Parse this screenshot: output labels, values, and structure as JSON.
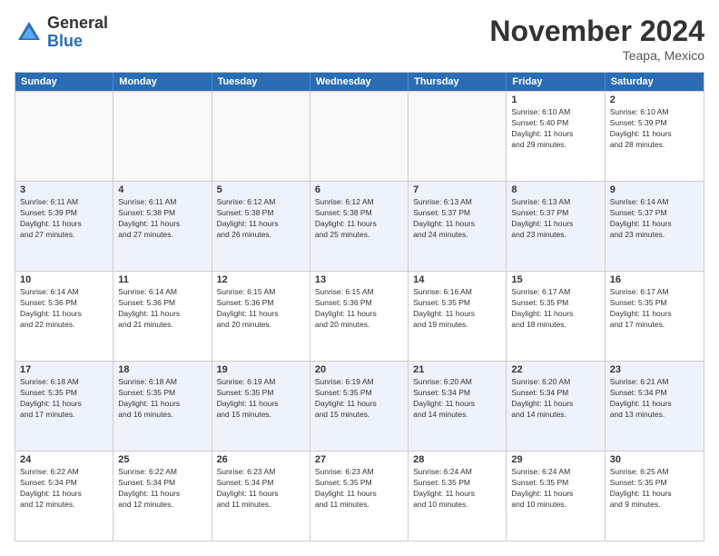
{
  "header": {
    "logo_general": "General",
    "logo_blue": "Blue",
    "month_title": "November 2024",
    "location": "Teapa, Mexico"
  },
  "weekdays": [
    "Sunday",
    "Monday",
    "Tuesday",
    "Wednesday",
    "Thursday",
    "Friday",
    "Saturday"
  ],
  "rows": [
    {
      "alt": false,
      "cells": [
        {
          "day": "",
          "empty": true,
          "info": ""
        },
        {
          "day": "",
          "empty": true,
          "info": ""
        },
        {
          "day": "",
          "empty": true,
          "info": ""
        },
        {
          "day": "",
          "empty": true,
          "info": ""
        },
        {
          "day": "",
          "empty": true,
          "info": ""
        },
        {
          "day": "1",
          "empty": false,
          "info": "Sunrise: 6:10 AM\nSunset: 5:40 PM\nDaylight: 11 hours\nand 29 minutes."
        },
        {
          "day": "2",
          "empty": false,
          "info": "Sunrise: 6:10 AM\nSunset: 5:39 PM\nDaylight: 11 hours\nand 28 minutes."
        }
      ]
    },
    {
      "alt": true,
      "cells": [
        {
          "day": "3",
          "empty": false,
          "info": "Sunrise: 6:11 AM\nSunset: 5:39 PM\nDaylight: 11 hours\nand 27 minutes."
        },
        {
          "day": "4",
          "empty": false,
          "info": "Sunrise: 6:11 AM\nSunset: 5:38 PM\nDaylight: 11 hours\nand 27 minutes."
        },
        {
          "day": "5",
          "empty": false,
          "info": "Sunrise: 6:12 AM\nSunset: 5:38 PM\nDaylight: 11 hours\nand 26 minutes."
        },
        {
          "day": "6",
          "empty": false,
          "info": "Sunrise: 6:12 AM\nSunset: 5:38 PM\nDaylight: 11 hours\nand 25 minutes."
        },
        {
          "day": "7",
          "empty": false,
          "info": "Sunrise: 6:13 AM\nSunset: 5:37 PM\nDaylight: 11 hours\nand 24 minutes."
        },
        {
          "day": "8",
          "empty": false,
          "info": "Sunrise: 6:13 AM\nSunset: 5:37 PM\nDaylight: 11 hours\nand 23 minutes."
        },
        {
          "day": "9",
          "empty": false,
          "info": "Sunrise: 6:14 AM\nSunset: 5:37 PM\nDaylight: 11 hours\nand 23 minutes."
        }
      ]
    },
    {
      "alt": false,
      "cells": [
        {
          "day": "10",
          "empty": false,
          "info": "Sunrise: 6:14 AM\nSunset: 5:36 PM\nDaylight: 11 hours\nand 22 minutes."
        },
        {
          "day": "11",
          "empty": false,
          "info": "Sunrise: 6:14 AM\nSunset: 5:36 PM\nDaylight: 11 hours\nand 21 minutes."
        },
        {
          "day": "12",
          "empty": false,
          "info": "Sunrise: 6:15 AM\nSunset: 5:36 PM\nDaylight: 11 hours\nand 20 minutes."
        },
        {
          "day": "13",
          "empty": false,
          "info": "Sunrise: 6:15 AM\nSunset: 5:36 PM\nDaylight: 11 hours\nand 20 minutes."
        },
        {
          "day": "14",
          "empty": false,
          "info": "Sunrise: 6:16 AM\nSunset: 5:35 PM\nDaylight: 11 hours\nand 19 minutes."
        },
        {
          "day": "15",
          "empty": false,
          "info": "Sunrise: 6:17 AM\nSunset: 5:35 PM\nDaylight: 11 hours\nand 18 minutes."
        },
        {
          "day": "16",
          "empty": false,
          "info": "Sunrise: 6:17 AM\nSunset: 5:35 PM\nDaylight: 11 hours\nand 17 minutes."
        }
      ]
    },
    {
      "alt": true,
      "cells": [
        {
          "day": "17",
          "empty": false,
          "info": "Sunrise: 6:18 AM\nSunset: 5:35 PM\nDaylight: 11 hours\nand 17 minutes."
        },
        {
          "day": "18",
          "empty": false,
          "info": "Sunrise: 6:18 AM\nSunset: 5:35 PM\nDaylight: 11 hours\nand 16 minutes."
        },
        {
          "day": "19",
          "empty": false,
          "info": "Sunrise: 6:19 AM\nSunset: 5:35 PM\nDaylight: 11 hours\nand 15 minutes."
        },
        {
          "day": "20",
          "empty": false,
          "info": "Sunrise: 6:19 AM\nSunset: 5:35 PM\nDaylight: 11 hours\nand 15 minutes."
        },
        {
          "day": "21",
          "empty": false,
          "info": "Sunrise: 6:20 AM\nSunset: 5:34 PM\nDaylight: 11 hours\nand 14 minutes."
        },
        {
          "day": "22",
          "empty": false,
          "info": "Sunrise: 6:20 AM\nSunset: 5:34 PM\nDaylight: 11 hours\nand 14 minutes."
        },
        {
          "day": "23",
          "empty": false,
          "info": "Sunrise: 6:21 AM\nSunset: 5:34 PM\nDaylight: 11 hours\nand 13 minutes."
        }
      ]
    },
    {
      "alt": false,
      "cells": [
        {
          "day": "24",
          "empty": false,
          "info": "Sunrise: 6:22 AM\nSunset: 5:34 PM\nDaylight: 11 hours\nand 12 minutes."
        },
        {
          "day": "25",
          "empty": false,
          "info": "Sunrise: 6:22 AM\nSunset: 5:34 PM\nDaylight: 11 hours\nand 12 minutes."
        },
        {
          "day": "26",
          "empty": false,
          "info": "Sunrise: 6:23 AM\nSunset: 5:34 PM\nDaylight: 11 hours\nand 11 minutes."
        },
        {
          "day": "27",
          "empty": false,
          "info": "Sunrise: 6:23 AM\nSunset: 5:35 PM\nDaylight: 11 hours\nand 11 minutes."
        },
        {
          "day": "28",
          "empty": false,
          "info": "Sunrise: 6:24 AM\nSunset: 5:35 PM\nDaylight: 11 hours\nand 10 minutes."
        },
        {
          "day": "29",
          "empty": false,
          "info": "Sunrise: 6:24 AM\nSunset: 5:35 PM\nDaylight: 11 hours\nand 10 minutes."
        },
        {
          "day": "30",
          "empty": false,
          "info": "Sunrise: 6:25 AM\nSunset: 5:35 PM\nDaylight: 11 hours\nand 9 minutes."
        }
      ]
    }
  ]
}
